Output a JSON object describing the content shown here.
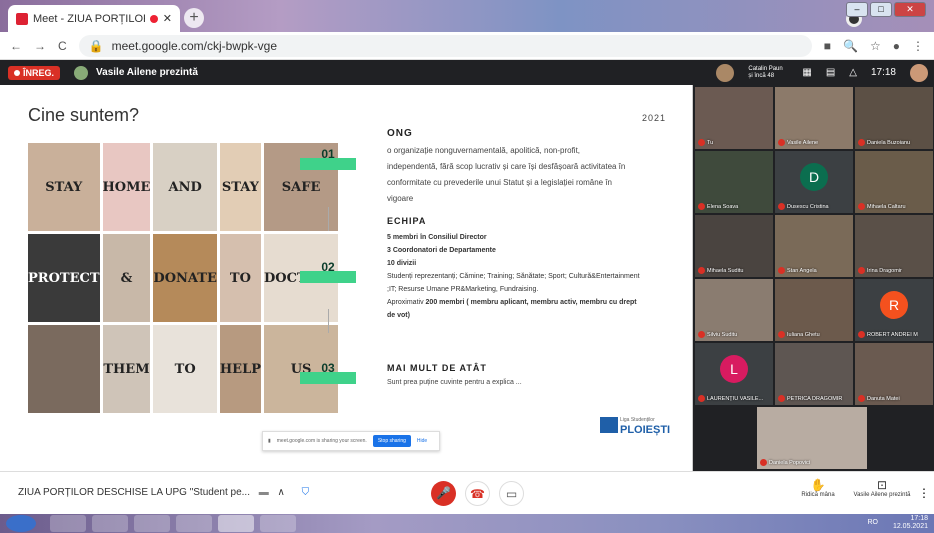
{
  "browser": {
    "tab_title": "Meet - ZIUA PORȚILOR DESC",
    "url": "meet.google.com/ckj-bwpk-vge"
  },
  "meet": {
    "rec_label": "ÎNREG.",
    "presenter": "Vasile Ailene prezintă",
    "others": "Catalin Paun\nși încă 48",
    "time": "17:18"
  },
  "slide": {
    "title": "Cine suntem?",
    "year": "2021",
    "nums": [
      "01",
      "02",
      "03"
    ],
    "photo_words": [
      "STAY",
      "HOME",
      "AND",
      "STAY",
      "SAFE",
      "PROTECT",
      "&",
      "DONATE",
      "TO",
      "DOCTORS",
      "",
      "THEM",
      "TO",
      "HELP",
      "US"
    ],
    "ong_heading": "ONG",
    "ong_text": "o organizație nonguvernamentală, apolitică, non-profit, independentă, fără scop lucrativ și care își desfășoară activitatea în conformitate cu prevederile unui Statut și a legislației române în vigoare",
    "echipa_heading": "ECHIPA",
    "echipa_lines": [
      "5 membri în Consiliul Director",
      "3 Coordonatori de Departamente",
      "10 divizii"
    ],
    "echipa_text": "Studenți reprezentanți; Cămine; Training; Sănătate; Sport; Cultură&Entertainment ;IT; Resurse Umane PR&Marketing, Fundraising.",
    "aprox_text": "Aproximativ",
    "aprox_bold": "200 membri ( membru aplicant, membru activ, membru cu drept de vot)",
    "mai_heading": "MAI MULT DE ATÂT",
    "mai_text": "Sunt prea puține cuvinte pentru a explica ...",
    "logo_small": "Liga Studenților",
    "logo_text": "PLOIEȘTI"
  },
  "share_bar": {
    "text": "meet.google.com is sharing your screen.",
    "stop": "Stop sharing",
    "hide": "Hide"
  },
  "participants": [
    {
      "name": "Tu"
    },
    {
      "name": "Vasile Ailene"
    },
    {
      "name": "Daniela Buzoianu"
    },
    {
      "name": "Elena Soava"
    },
    {
      "name": "Dusescu Cristina",
      "initial": "D",
      "color": "#0b6e4f"
    },
    {
      "name": "Mihaela Caltaru"
    },
    {
      "name": "Mihaela Suditu"
    },
    {
      "name": "Stan Angela"
    },
    {
      "name": "Irina Dragomir"
    },
    {
      "name": "Silviu Suditu"
    },
    {
      "name": "Iuliana Ghetu"
    },
    {
      "name": "ROBERT ANDREI M",
      "initial": "R",
      "color": "#f4511e"
    },
    {
      "name": "LAURENȚIU VASILE...",
      "initial": "L",
      "color": "#d81b60"
    },
    {
      "name": "PETRICA DRAGOMIR"
    },
    {
      "name": "Danuta Matei"
    },
    {
      "name": "Daniela Popovici"
    }
  ],
  "bottom": {
    "meeting_title": "ZIUA PORȚILOR DESCHISE LA UPG \"Student pe...",
    "raise_hand": "Ridică mâna",
    "presenting": "Vasile Ailene prezintă"
  },
  "taskbar": {
    "lang": "RO",
    "time": "17:18",
    "date": "12.05.2021"
  }
}
